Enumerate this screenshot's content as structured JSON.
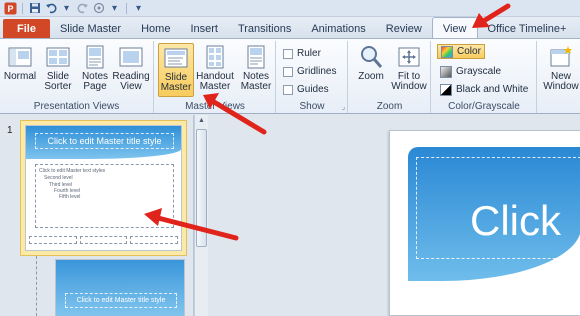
{
  "quick_access": {
    "items": [
      "save-icon",
      "undo-icon",
      "redo-icon",
      "touch-icon",
      "customize-icon"
    ]
  },
  "tabs": [
    {
      "label": "File",
      "active": false
    },
    {
      "label": "Slide Master",
      "active": false
    },
    {
      "label": "Home",
      "active": false
    },
    {
      "label": "Insert",
      "active": false
    },
    {
      "label": "Transitions",
      "active": false
    },
    {
      "label": "Animations",
      "active": false
    },
    {
      "label": "Review",
      "active": false
    },
    {
      "label": "View",
      "active": true
    },
    {
      "label": "Office Timeline+",
      "active": false
    }
  ],
  "ribbon": {
    "presentation_views": {
      "label": "Presentation Views",
      "normal": "Normal",
      "slide_sorter": "Slide Sorter",
      "notes_page": "Notes Page",
      "reading_view": "Reading View"
    },
    "master_views": {
      "label": "Master Views",
      "slide_master": "Slide Master",
      "handout_master": "Handout Master",
      "notes_master": "Notes Master"
    },
    "show": {
      "label": "Show",
      "ruler": "Ruler",
      "gridlines": "Gridlines",
      "guides": "Guides"
    },
    "zoom": {
      "label": "Zoom",
      "zoom": "Zoom",
      "fit_to_window": "Fit to Window"
    },
    "color_grayscale": {
      "label": "Color/Grayscale",
      "color": "Color",
      "grayscale": "Grayscale",
      "black_and_white": "Black and White"
    },
    "window": {
      "new_window": "New Window"
    }
  },
  "thumbnail_pane": {
    "slide_number": "1",
    "thumb_title": "Click to edit Master title style",
    "thumb_body": [
      "Click to edit Master text styles",
      "Second level",
      "Third level",
      "Fourth level",
      "Fifth level"
    ],
    "thumb2_title": "Click to edit Master title style"
  },
  "editor": {
    "slide_title": "Click"
  },
  "colors": {
    "file_tab": "#d24726",
    "accent_arrow": "#e0231b",
    "slide_blue": "#2a88d4",
    "pressed_button": "#f8cc5d"
  }
}
